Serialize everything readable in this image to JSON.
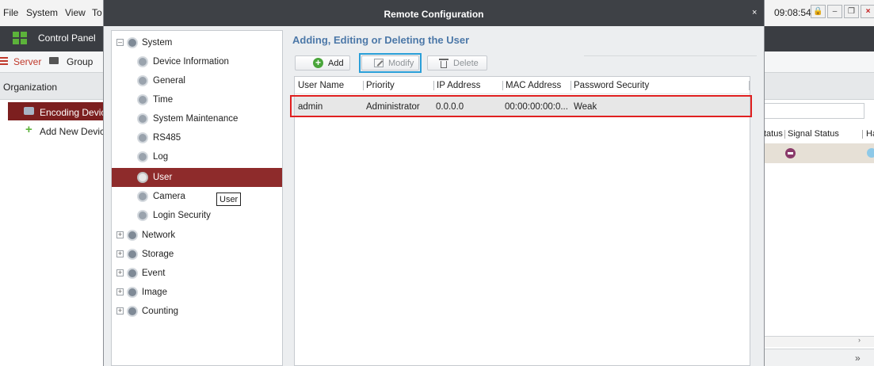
{
  "app": {
    "menu": [
      "File",
      "System",
      "View",
      "To"
    ],
    "clock": "09:08:54",
    "window_controls": [
      "lock-icon",
      "minimize-icon",
      "restore-icon",
      "close-icon"
    ],
    "control_panel": "Control Panel",
    "tabs": [
      {
        "label": "Server",
        "active": true
      },
      {
        "label": "Group",
        "active": false
      }
    ],
    "organization_label": "Organization",
    "tree": [
      {
        "label": "Encoding Device",
        "selected": true
      },
      {
        "label": "Add New Device"
      }
    ],
    "right_columns": [
      "tatus",
      "Signal Status",
      "Ha"
    ]
  },
  "dialog": {
    "title": "Remote Configuration",
    "close_glyph": "×",
    "tooltip": "User",
    "nav": {
      "system": "System",
      "system_children": [
        "Device Information",
        "General",
        "Time",
        "System Maintenance",
        "RS485",
        "Log",
        "User",
        "Camera",
        "Login Security"
      ],
      "selected": "User",
      "collapsed": [
        "Network",
        "Storage",
        "Event",
        "Image",
        "Counting"
      ]
    },
    "section_title": "Adding, Editing or Deleting the User",
    "toolbar": {
      "add": "Add",
      "modify": "Modify",
      "delete": "Delete"
    },
    "table": {
      "columns": [
        "User Name",
        "Priority",
        "IP Address",
        "MAC Address",
        "Password Security"
      ],
      "rows": [
        [
          "admin",
          "Administrator",
          "0.0.0.0",
          "00:00:00:00:0...",
          "Weak"
        ]
      ]
    }
  },
  "colors": {
    "accent_red": "#8e2b2b",
    "title_blue": "#4c78a8",
    "focus_blue": "#2a9fd8",
    "highlight_red": "#e02020",
    "add_green": "#49a53a"
  }
}
